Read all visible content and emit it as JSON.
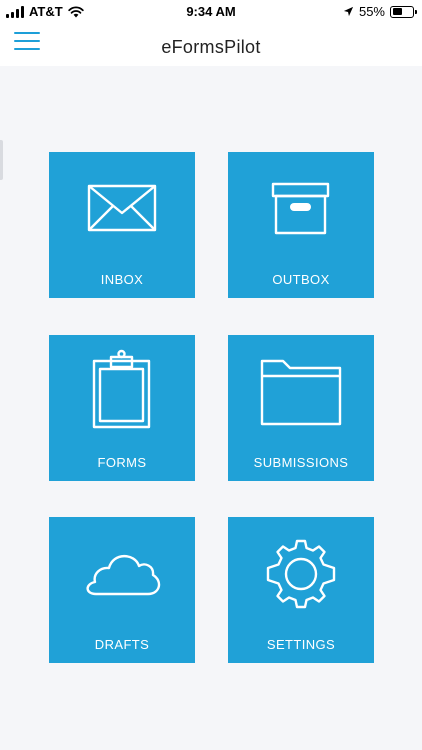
{
  "status_bar": {
    "carrier": "AT&T",
    "time": "9:34 AM",
    "battery_percent": "55%",
    "battery_level": 0.55
  },
  "header": {
    "title": "eFormsPilot",
    "menu_icon": "hamburger-menu-icon"
  },
  "colors": {
    "accent": "#20a1d7",
    "background": "#f5f6f9",
    "header": "#ffffff"
  },
  "tiles": [
    {
      "label": "INBOX",
      "icon": "envelope-icon"
    },
    {
      "label": "OUTBOX",
      "icon": "archive-box-icon"
    },
    {
      "label": "FORMS",
      "icon": "clipboard-icon"
    },
    {
      "label": "SUBMISSIONS",
      "icon": "folder-icon"
    },
    {
      "label": "DRAFTS",
      "icon": "cloud-icon"
    },
    {
      "label": "SETTINGS",
      "icon": "gear-icon"
    }
  ]
}
